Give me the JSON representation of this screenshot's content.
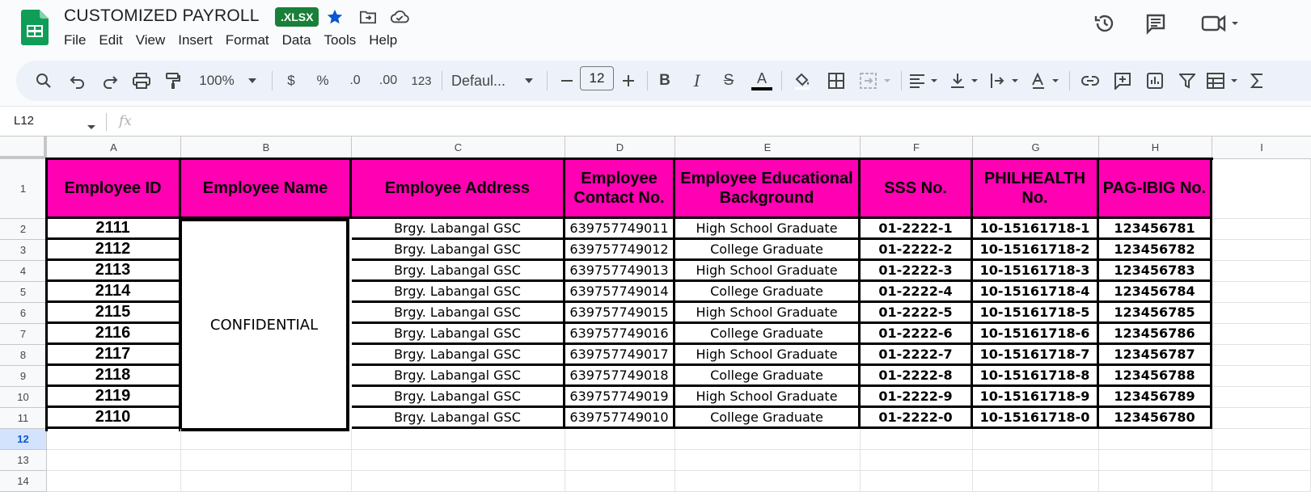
{
  "app": {
    "doc_title": "CUSTOMIZED PAYROLL",
    "badge": ".XLSX",
    "brand_color": "#0f9d58",
    "accent": "#ff00b3"
  },
  "menu": [
    "File",
    "Edit",
    "View",
    "Insert",
    "Format",
    "Data",
    "Tools",
    "Help"
  ],
  "toolbar": {
    "zoom": "100%",
    "currency": "$",
    "percent": "%",
    "dec_decrease": ".0",
    "dec_increase": ".00",
    "number_format": "123",
    "font": "Defaul...",
    "font_size": "12",
    "bold": "B",
    "italic": "I",
    "strike": "S",
    "text_color": "A"
  },
  "formula_bar": {
    "name_box": "L12",
    "fx": "fx",
    "value": ""
  },
  "columns": [
    "A",
    "B",
    "C",
    "D",
    "E",
    "F",
    "G",
    "H",
    "I"
  ],
  "rows": [
    "1",
    "2",
    "3",
    "4",
    "5",
    "6",
    "7",
    "8",
    "9",
    "10",
    "11",
    "12",
    "13",
    "14"
  ],
  "selected_row": "12",
  "table": {
    "headers": [
      "Employee ID",
      "Employee Name",
      "Employee Address",
      "Employee Contact No.",
      "Employee Educational Background",
      "SSS No.",
      "PHILHEALTH No.",
      "PAG-IBIG No."
    ],
    "merged_name": "CONFIDENTIAL",
    "records": [
      {
        "id": "2111",
        "address": "Brgy. Labangal GSC",
        "contact": "639757749011",
        "education": "High School Graduate",
        "sss": "01-2222-1",
        "philhealth": "10-15161718-1",
        "pagibig": "123456781"
      },
      {
        "id": "2112",
        "address": "Brgy. Labangal GSC",
        "contact": "639757749012",
        "education": "College Graduate",
        "sss": "01-2222-2",
        "philhealth": "10-15161718-2",
        "pagibig": "123456782"
      },
      {
        "id": "2113",
        "address": "Brgy. Labangal GSC",
        "contact": "639757749013",
        "education": "High School Graduate",
        "sss": "01-2222-3",
        "philhealth": "10-15161718-3",
        "pagibig": "123456783"
      },
      {
        "id": "2114",
        "address": "Brgy. Labangal GSC",
        "contact": "639757749014",
        "education": "College Graduate",
        "sss": "01-2222-4",
        "philhealth": "10-15161718-4",
        "pagibig": "123456784"
      },
      {
        "id": "2115",
        "address": "Brgy. Labangal GSC",
        "contact": "639757749015",
        "education": "High School Graduate",
        "sss": "01-2222-5",
        "philhealth": "10-15161718-5",
        "pagibig": "123456785"
      },
      {
        "id": "2116",
        "address": "Brgy. Labangal GSC",
        "contact": "639757749016",
        "education": "College Graduate",
        "sss": "01-2222-6",
        "philhealth": "10-15161718-6",
        "pagibig": "123456786"
      },
      {
        "id": "2117",
        "address": "Brgy. Labangal GSC",
        "contact": "639757749017",
        "education": "High School Graduate",
        "sss": "01-2222-7",
        "philhealth": "10-15161718-7",
        "pagibig": "123456787"
      },
      {
        "id": "2118",
        "address": "Brgy. Labangal GSC",
        "contact": "639757749018",
        "education": "College Graduate",
        "sss": "01-2222-8",
        "philhealth": "10-15161718-8",
        "pagibig": "123456788"
      },
      {
        "id": "2119",
        "address": "Brgy. Labangal GSC",
        "contact": "639757749019",
        "education": "High School Graduate",
        "sss": "01-2222-9",
        "philhealth": "10-15161718-9",
        "pagibig": "123456789"
      },
      {
        "id": "2110",
        "address": "Brgy. Labangal GSC",
        "contact": "639757749010",
        "education": "College Graduate",
        "sss": "01-2222-0",
        "philhealth": "10-15161718-0",
        "pagibig": "123456780"
      }
    ]
  }
}
